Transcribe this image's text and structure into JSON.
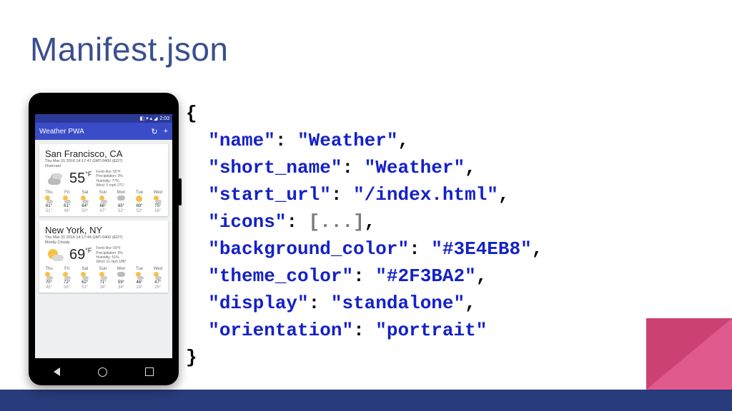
{
  "slide": {
    "title": "Manifest.json"
  },
  "manifest": {
    "name_key": "\"name\"",
    "name_val": "\"Weather\"",
    "short_name_key": "\"short_name\"",
    "short_name_val": "\"Weather\"",
    "start_url_key": "\"start_url\"",
    "start_url_val": "\"/index.html\"",
    "icons_key": "\"icons\"",
    "icons_val": "[...]",
    "background_color_key": "\"background_color\"",
    "background_color_val": "\"#3E4EB8\"",
    "theme_color_key": "\"theme_color\"",
    "theme_color_val": "\"#2F3BA2\"",
    "display_key": "\"display\"",
    "display_val": "\"standalone\"",
    "orientation_key": "\"orientation\"",
    "orientation_val": "\"portrait\""
  },
  "phone": {
    "status": {
      "time": "2:03",
      "icons": "◧ ▾ ▴ ◢"
    },
    "appbar": {
      "title": "Weather PWA",
      "refresh_icon": "↻",
      "add_icon": "+"
    },
    "cards": [
      {
        "city": "San Francisco, CA",
        "datetime": "Thu Mar 31 2016 14:17:47 GMT-0400 (EDT)",
        "summary": "Overcast",
        "icon": "cloudy",
        "temp": "55",
        "unit": "°F",
        "stats": {
          "feels_like": "Feels like: 55°F",
          "precip": "Precipitation: 0%",
          "humidity": "Humidity: 77%",
          "wind": "Wind: 5 mph 271°"
        },
        "forecast": [
          {
            "day": "Thu",
            "icon": "partly",
            "hi": "61°",
            "lo": "51°"
          },
          {
            "day": "Fri",
            "icon": "partly",
            "hi": "61°",
            "lo": "48°"
          },
          {
            "day": "Sat",
            "icon": "partly",
            "hi": "64°",
            "lo": "50°"
          },
          {
            "day": "Sun",
            "icon": "partly",
            "hi": "66°",
            "lo": "47°"
          },
          {
            "day": "Mon",
            "icon": "cloud",
            "hi": "65°",
            "lo": "52°"
          },
          {
            "day": "Tue",
            "icon": "sun",
            "hi": "69°",
            "lo": "53°"
          },
          {
            "day": "Wed",
            "icon": "partly",
            "hi": "75°",
            "lo": "56°"
          }
        ]
      },
      {
        "city": "New York, NY",
        "datetime": "Thu Mar 31 2016 14:17:44 GMT-0400 (EDT)",
        "summary": "Mostly Cloudy",
        "icon": "partly",
        "temp": "69",
        "unit": "°F",
        "stats": {
          "feels_like": "Feels like: 69°F",
          "precip": "Precipitation: 0%",
          "humidity": "Humidity: 51%",
          "wind": "Wind: 11 mph 188°"
        },
        "forecast": [
          {
            "day": "Thu",
            "icon": "partly",
            "hi": "70°",
            "lo": "45°"
          },
          {
            "day": "Fri",
            "icon": "partly",
            "hi": "72°",
            "lo": "56°"
          },
          {
            "day": "Sat",
            "icon": "partly",
            "hi": "62°",
            "lo": "51°"
          },
          {
            "day": "Sun",
            "icon": "partly",
            "hi": "71°",
            "lo": "34°"
          },
          {
            "day": "Mon",
            "icon": "cloud",
            "hi": "59°",
            "lo": "34°"
          },
          {
            "day": "Tue",
            "icon": "partly",
            "hi": "46°",
            "lo": "28°"
          },
          {
            "day": "Wed",
            "icon": "partly",
            "hi": "47°",
            "lo": "26°"
          }
        ]
      }
    ]
  }
}
